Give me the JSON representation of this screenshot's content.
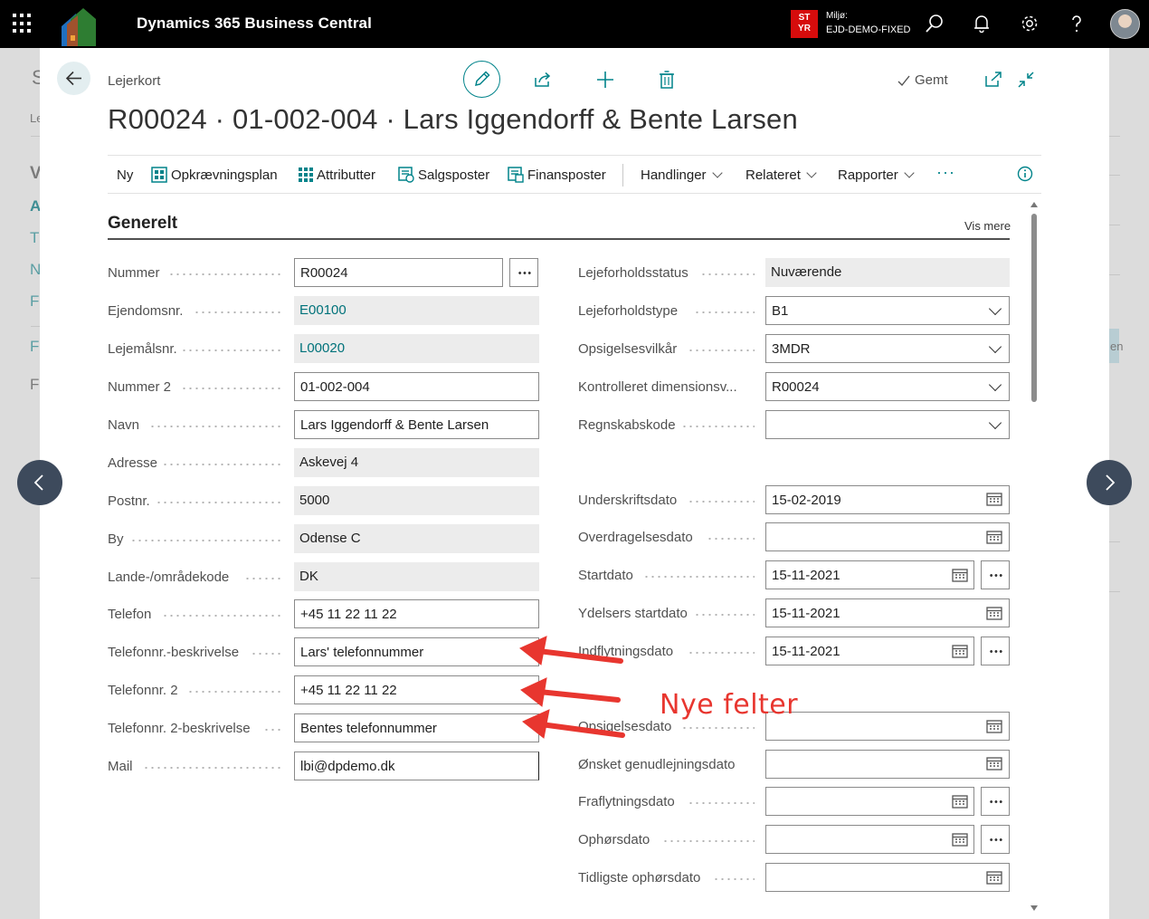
{
  "topbar": {
    "app_title": "Dynamics 365 Business Central",
    "env_badge_line1": "ST",
    "env_badge_line2": "YR",
    "env_label": "Miljø:",
    "env_name": "EJD-DEMO-FIXED"
  },
  "background_fragments": [
    "S",
    "Le",
    "V",
    "A",
    "T",
    "N",
    "Fi",
    "Fi",
    "Fi",
    "en"
  ],
  "header": {
    "breadcrumb": "Lejerkort",
    "saved_label": "Gemt",
    "title": "R00024 · 01-002-004 · Lars Iggendorff & Bente Larsen"
  },
  "actions": {
    "new": "Ny",
    "billing_plan": "Opkrævningsplan",
    "attributes": "Attributter",
    "sales_entries": "Salgsposter",
    "finance_entries": "Finansposter",
    "actions_menu": "Handlinger",
    "related_menu": "Relateret",
    "reports_menu": "Rapporter",
    "more": "···"
  },
  "section": {
    "title": "Generelt",
    "show_more": "Vis mere"
  },
  "left_fields": [
    {
      "label": "Nummer",
      "value": "R00024"
    },
    {
      "label": "Ejendomsnr.",
      "value": "E00100"
    },
    {
      "label": "Lejemålsnr.",
      "value": "L00020"
    },
    {
      "label": "Nummer 2",
      "value": "01-002-004"
    },
    {
      "label": "Navn",
      "value": "Lars Iggendorff & Bente Larsen"
    },
    {
      "label": "Adresse",
      "value": "Askevej 4"
    },
    {
      "label": "Postnr.",
      "value": "5000"
    },
    {
      "label": "By",
      "value": "Odense C"
    },
    {
      "label": "Lande-/områdekode",
      "value": "DK"
    },
    {
      "label": "Telefon",
      "value": "+45 11 22 11 22"
    },
    {
      "label": "Telefonnr.-beskrivelse",
      "value": "Lars' telefonnummer"
    },
    {
      "label": "Telefonnr. 2",
      "value": "+45 11 22 11 22"
    },
    {
      "label": "Telefonnr. 2-beskrivelse",
      "value": "Bentes telefonnummer"
    },
    {
      "label": "Mail",
      "value": "lbi@dpdemo.dk"
    }
  ],
  "right_fields": [
    {
      "label": "Lejeforholdsstatus",
      "value": "Nuværende"
    },
    {
      "label": "Lejeforholdstype",
      "value": "B1"
    },
    {
      "label": "Opsigelsesvilkår",
      "value": "3MDR"
    },
    {
      "label": "Kontrolleret dimensionsv...",
      "value": "R00024"
    },
    {
      "label": "Regnskabskode",
      "value": ""
    },
    {
      "label": "Underskriftsdato",
      "value": "15-02-2019"
    },
    {
      "label": "Overdragelsesdato",
      "value": ""
    },
    {
      "label": "Startdato",
      "value": "15-11-2021"
    },
    {
      "label": "Ydelsers startdato",
      "value": "15-11-2021"
    },
    {
      "label": "Indflytningsdato",
      "value": "15-11-2021"
    },
    {
      "label": "Opsigelsesdato",
      "value": ""
    },
    {
      "label": "Ønsket genudlejningsdato",
      "value": ""
    },
    {
      "label": "Fraflytningsdato",
      "value": ""
    },
    {
      "label": "Ophørsdato",
      "value": ""
    },
    {
      "label": "Tidligste ophørsdato",
      "value": ""
    }
  ],
  "annotation": {
    "text": "Nye felter",
    "color": "#e8362f"
  },
  "colors": {
    "accent": "#00838a",
    "topbar": "#000000",
    "env_badge": "#d60c0c",
    "nav_button": "#3d4a5c"
  }
}
